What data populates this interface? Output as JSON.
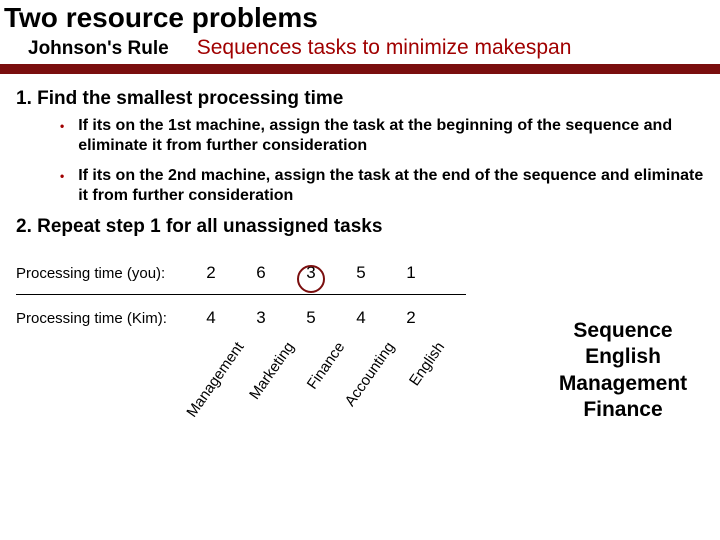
{
  "title": "Two resource problems",
  "subtitle": {
    "rule_name": "Johnson's Rule",
    "rule_desc": "Sequences tasks to minimize makespan"
  },
  "steps": {
    "s1": "1.  Find the smallest processing time",
    "b1": "If its on the 1st machine, assign the task at the beginning of the sequence and eliminate it from further consideration",
    "b2": "If its on the 2nd machine, assign the task at the end of the sequence and eliminate it from further consideration",
    "s2": "2.  Repeat step 1 for all unassigned tasks"
  },
  "table": {
    "row1_label": "Processing time (you):",
    "row2_label": "Processing time (Kim):",
    "row1": [
      "2",
      "6",
      "3",
      "5",
      "1"
    ],
    "row2": [
      "4",
      "3",
      "5",
      "4",
      "2"
    ],
    "columns": [
      "Management",
      "Marketing",
      "Finance",
      "Accounting",
      "English"
    ]
  },
  "sequence": {
    "title": "Sequence",
    "lines": [
      "English",
      "Management",
      "Finance"
    ]
  },
  "chart_data": {
    "type": "table",
    "title": "Processing times — Johnson's Rule example",
    "columns": [
      "Management",
      "Marketing",
      "Finance",
      "Accounting",
      "English"
    ],
    "series": [
      {
        "name": "Processing time (you)",
        "values": [
          2,
          6,
          3,
          5,
          1
        ]
      },
      {
        "name": "Processing time (Kim)",
        "values": [
          4,
          3,
          5,
          4,
          2
        ]
      }
    ],
    "highlight": {
      "row": "Processing time (you)",
      "column": "Finance",
      "value": 3
    },
    "result_sequence": [
      "English",
      "Management",
      "Finance"
    ]
  }
}
